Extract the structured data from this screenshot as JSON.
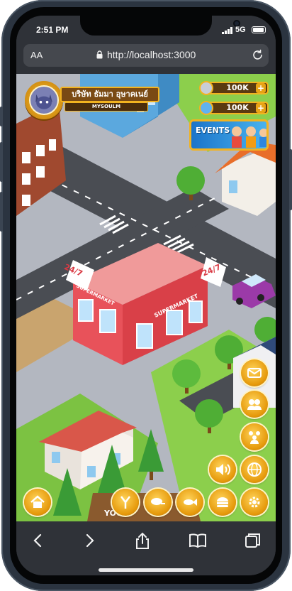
{
  "status_bar": {
    "time": "2:51 PM",
    "network": "5G"
  },
  "browser": {
    "text_size": "AA",
    "url": "http://localhost:3000"
  },
  "player": {
    "name": "บริษัท ธัมมา อุษาคเนย์",
    "tag": "MYSOULM"
  },
  "currencies": [
    {
      "icon": "silver-coin-icon",
      "amount": "100K"
    },
    {
      "icon": "gem-icon",
      "amount": "100K"
    }
  ],
  "events_label": "EVENTS",
  "store_signs": {
    "left": "24/7",
    "right": "24/7",
    "front": "SUPERMARKET",
    "side": "SUPERMARKET"
  },
  "billboard": "YOUR",
  "action_buttons": [
    {
      "name": "mail-button",
      "icon": "mail-icon"
    },
    {
      "name": "friends-button",
      "icon": "friends-icon"
    },
    {
      "name": "activity-button",
      "icon": "people-icon"
    },
    {
      "name": "sound-button",
      "icon": "speaker-icon"
    },
    {
      "name": "world-button",
      "icon": "globe-icon"
    },
    {
      "name": "settings-button",
      "icon": "gear-icon"
    },
    {
      "name": "home-button",
      "icon": "home-icon"
    },
    {
      "name": "cooking-button",
      "icon": "chef-icon"
    },
    {
      "name": "meat-button",
      "icon": "meat-icon"
    },
    {
      "name": "fish-button",
      "icon": "fish-icon"
    },
    {
      "name": "burger-button",
      "icon": "burger-icon"
    }
  ],
  "colors": {
    "gold": "#F2B320",
    "road": "#4A4D53",
    "grass": "#7CC242",
    "store": "#E8525A"
  }
}
